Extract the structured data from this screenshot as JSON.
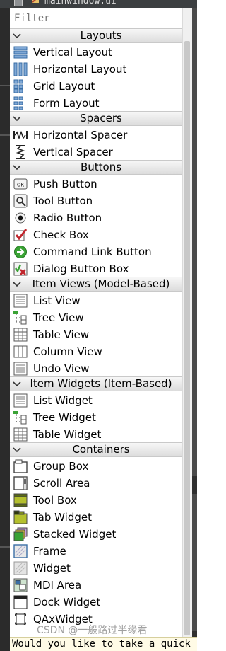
{
  "window": {
    "title": "mainwindow.ui"
  },
  "filter": {
    "placeholder": "Filter"
  },
  "sections": [
    {
      "title": "Layouts",
      "items": [
        "Vertical Layout",
        "Horizontal Layout",
        "Grid Layout",
        "Form Layout"
      ]
    },
    {
      "title": "Spacers",
      "items": [
        "Horizontal Spacer",
        "Vertical Spacer"
      ]
    },
    {
      "title": "Buttons",
      "items": [
        "Push Button",
        "Tool Button",
        "Radio Button",
        "Check Box",
        "Command Link Button",
        "Dialog Button Box"
      ]
    },
    {
      "title": "Item Views (Model-Based)",
      "items": [
        "List View",
        "Tree View",
        "Table View",
        "Column View",
        "Undo View"
      ]
    },
    {
      "title": "Item Widgets (Item-Based)",
      "items": [
        "List Widget",
        "Tree Widget",
        "Table Widget"
      ]
    },
    {
      "title": "Containers",
      "items": [
        "Group Box",
        "Scroll Area",
        "Tool Box",
        "Tab Widget",
        "Stacked Widget",
        "Frame",
        "Widget",
        "MDI Area",
        "Dock Widget",
        "QAxWidget"
      ]
    }
  ],
  "icons": {
    "sections": [
      [
        "vertical-layout-icon",
        "horizontal-layout-icon",
        "grid-layout-icon",
        "form-layout-icon"
      ],
      [
        "horizontal-spacer-icon",
        "vertical-spacer-icon"
      ],
      [
        "push-button-icon",
        "tool-button-icon",
        "radio-button-icon",
        "check-box-icon",
        "command-link-button-icon",
        "dialog-button-box-icon"
      ],
      [
        "list-view-icon",
        "tree-view-icon",
        "table-view-icon",
        "column-view-icon",
        "undo-view-icon"
      ],
      [
        "list-widget-icon",
        "tree-widget-icon",
        "table-widget-icon"
      ],
      [
        "group-box-icon",
        "scroll-area-icon",
        "tool-box-icon",
        "tab-widget-icon",
        "stacked-widget-icon",
        "frame-icon",
        "widget-icon",
        "mdi-area-icon",
        "dock-widget-icon",
        "qaxwidget-icon"
      ]
    ]
  },
  "colors": {
    "accent_blue": "#3a6ea5",
    "check_red": "#c0262d",
    "command_green": "#3aa335",
    "header_bg": "#e6e6e6"
  },
  "watermark": {
    "text": "CSDN @一般路过半缘君"
  },
  "status_bar": {
    "text": "Would you like to take a quick t"
  }
}
